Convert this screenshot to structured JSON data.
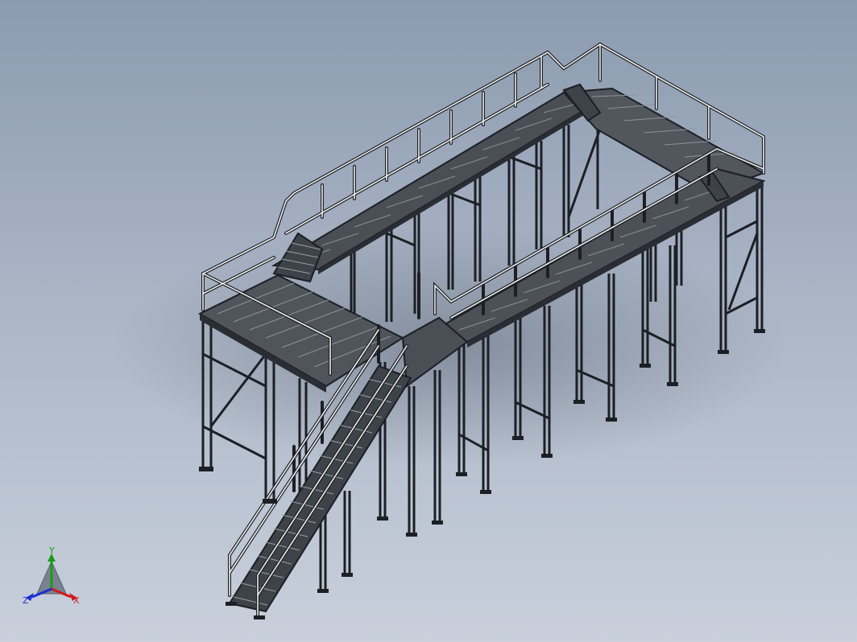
{
  "viewport": {
    "background_top": "#8c9bb0",
    "background_bottom": "#c9d0dc"
  },
  "model": {
    "description_icon": "steel-platform-with-stairs-model",
    "line_color": "#1c1f24",
    "rail_color": "#e8e8e8"
  },
  "triad": {
    "x_label": "X",
    "y_label": "Y",
    "z_label": "Z",
    "x_color": "#d11a1a",
    "y_color": "#1a9a1a",
    "z_color": "#1a2fd1"
  }
}
